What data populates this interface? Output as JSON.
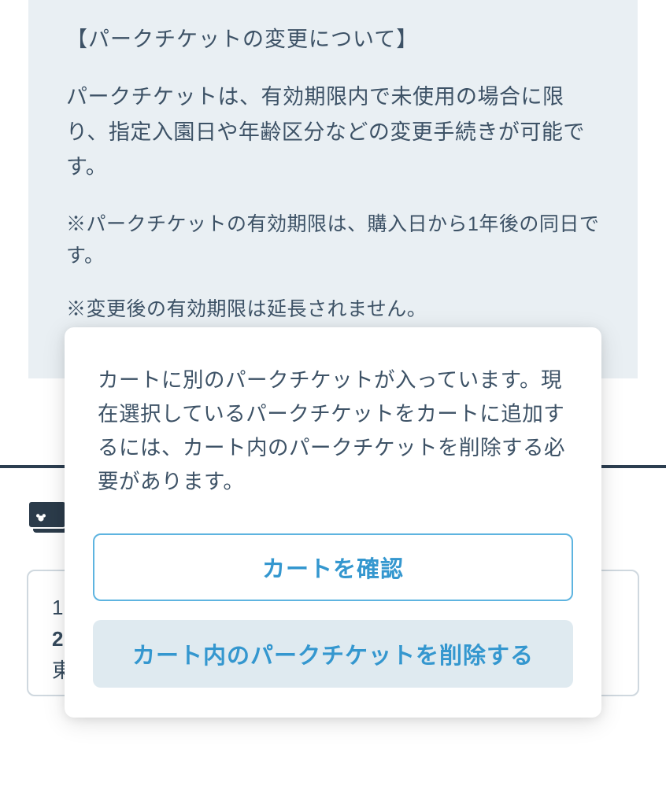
{
  "notice": {
    "heading": "【パークチケットの変更について】",
    "body": "パークチケットは、有効期限内で未使用の場合に限り、指定入園日や年齢区分などの変更手続きが可能です。",
    "note1": "※パークチケットの有効期限は、購入日から1年後の同日です。",
    "note2": "※変更後の有効期限は延長されません。"
  },
  "ticket_card": {
    "line1": "1",
    "line2": "2",
    "line3": "東"
  },
  "modal": {
    "message": "カートに別のパークチケットが入っています。現在選択しているパークチケットをカートに追加するには、カート内のパークチケットを削除する必要があります。",
    "confirm_cart_label": "カートを確認",
    "delete_cart_label": "カート内のパークチケットを削除する"
  },
  "icons": {
    "ticket_icon_name": "ticket-icon"
  }
}
